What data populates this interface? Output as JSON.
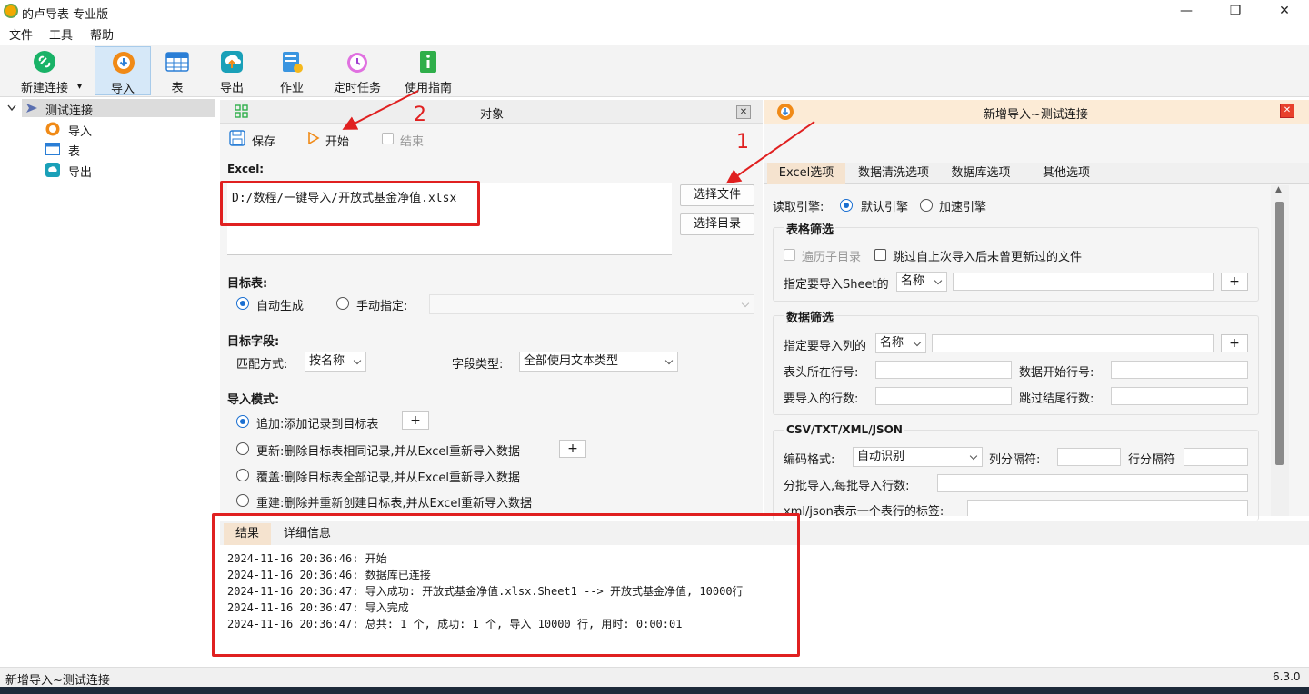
{
  "window": {
    "title": "的卢导表 专业版",
    "minimize": "—",
    "maximize": "❐",
    "close": "✕"
  },
  "menu": [
    "文件",
    "工具",
    "帮助"
  ],
  "toolbar": {
    "items": [
      {
        "label": "新建连接",
        "icon": "link-icon",
        "color": "#19b267"
      },
      {
        "label": "导入",
        "icon": "import-icon",
        "color": "#f08a17"
      },
      {
        "label": "表",
        "icon": "table-icon",
        "color": "#2a7ed6"
      },
      {
        "label": "导出",
        "icon": "export-icon",
        "color": "#1aa0b8"
      },
      {
        "label": "作业",
        "icon": "job-icon",
        "color": "#3a95e0"
      },
      {
        "label": "定时任务",
        "icon": "timer-icon",
        "color": "#a040d0"
      },
      {
        "label": "使用指南",
        "icon": "guide-icon",
        "color": "#2fae4a"
      }
    ],
    "dropdown": "▾"
  },
  "tree": {
    "root": "测试连接",
    "children": [
      "导入",
      "表",
      "导出"
    ]
  },
  "object_panel": {
    "title": "对象",
    "save": "保存",
    "start": "开始",
    "stop": "结束",
    "excel_label": "Excel:",
    "excel_path": "D:/数程/一键导入/开放式基金净值.xlsx",
    "select_file": "选择文件",
    "select_dir": "选择目录",
    "target_table_label": "目标表:",
    "auto_generate": "自动生成",
    "manual_specify": "手动指定:",
    "target_fields_label": "目标字段:",
    "match_label": "匹配方式:",
    "match_value": "按名称",
    "field_type_label": "字段类型:",
    "field_type_value": "全部使用文本类型",
    "import_mode_label": "导入模式:",
    "modes": [
      "追加:添加记录到目标表",
      "更新:删除目标表相同记录,并从Excel重新导入数据",
      "覆盖:删除目标表全部记录,并从Excel重新导入数据",
      "重建:删除并重新创建目标表,并从Excel重新导入数据"
    ],
    "plus": "+"
  },
  "right_panel": {
    "title": "新增导入~测试连接",
    "tabs": [
      "Excel选项",
      "数据清洗选项",
      "数据库选项",
      "其他选项"
    ],
    "engine_label": "读取引擎:",
    "engine_default": "默认引擎",
    "engine_fast": "加速引擎",
    "sheet_filter": "表格筛选",
    "traverse_subdir": "遍历子目录",
    "skip_unchanged": "跳过自上次导入后未曾更新过的文件",
    "specify_sheet": "指定要导入Sheet的",
    "name_option": "名称",
    "data_filter": "数据筛选",
    "specify_columns": "指定要导入列的",
    "header_row": "表头所在行号:",
    "data_start_row": "数据开始行号:",
    "rows_to_import": "要导入的行数:",
    "skip_tail_rows": "跳过结尾行数:",
    "csv_group": "CSV/TXT/XML/JSON",
    "encoding_label": "编码格式:",
    "encoding_value": "自动识别",
    "col_sep": "列分隔符:",
    "row_sep": "行分隔符",
    "batch_label": "分批导入,每批导入行数:",
    "xml_label": "xml/json表示一个表行的标签:",
    "plus": "+"
  },
  "result": {
    "tabs": [
      "结果",
      "详细信息"
    ],
    "log": [
      "2024-11-16 20:36:46: 开始",
      "2024-11-16 20:36:46: 数据库已连接",
      "2024-11-16 20:36:47: 导入成功: 开放式基金净值.xlsx.Sheet1 --> 开放式基金净值, 10000行",
      "2024-11-16 20:36:47: 导入完成",
      "2024-11-16 20:36:47: 总共: 1 个, 成功: 1 个, 导入 10000 行, 用时: 0:00:01"
    ]
  },
  "annotations": {
    "one": "1",
    "two": "2"
  },
  "status": {
    "left": "新增导入~测试连接",
    "version": "6.3.0"
  },
  "colors": {
    "accent": "#1a6fd1",
    "annotation": "#e02020",
    "header_bg": "#fcebd6"
  }
}
